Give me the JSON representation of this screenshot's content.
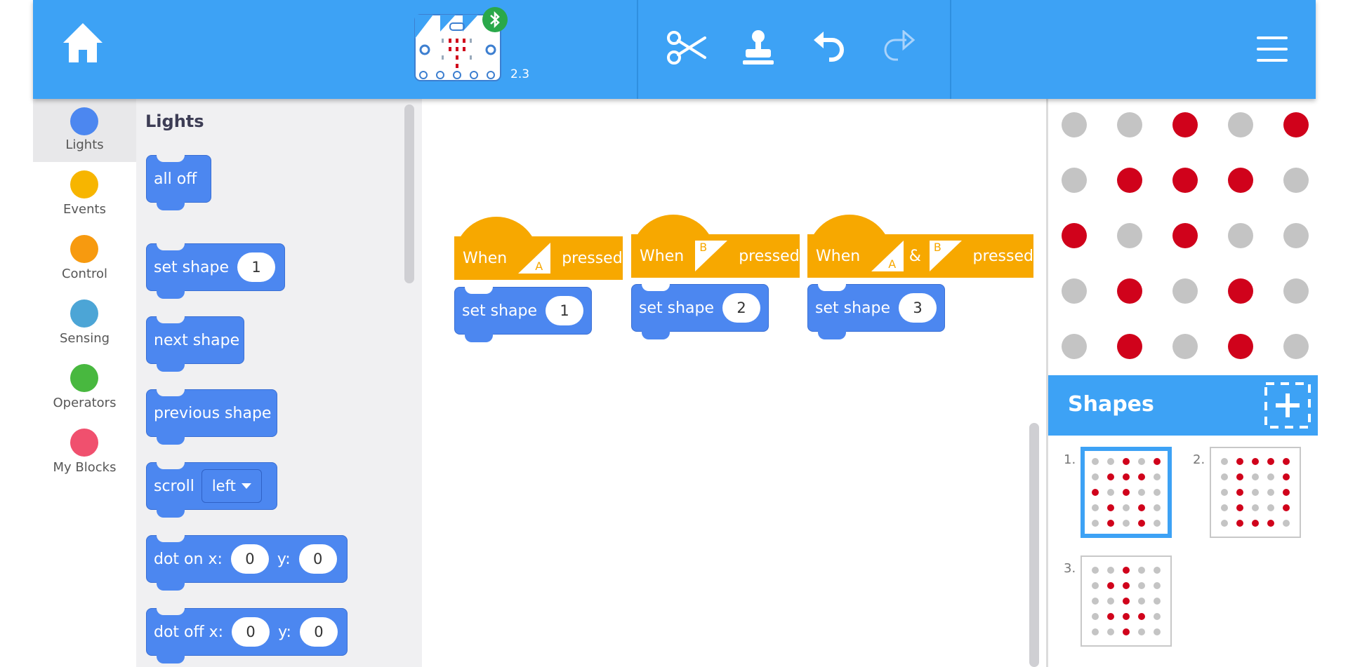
{
  "header": {
    "device_version": "2.3",
    "icons": [
      "home-icon",
      "microbit-device-icon",
      "bluetooth-icon",
      "scissors-icon",
      "stamp-icon",
      "undo-icon",
      "redo-icon",
      "menu-icon"
    ]
  },
  "categories": [
    {
      "label": "Lights",
      "color": "#4c87f0",
      "active": true
    },
    {
      "label": "Events",
      "color": "#f7b500",
      "active": false
    },
    {
      "label": "Control",
      "color": "#f79a0f",
      "active": false
    },
    {
      "label": "Sensing",
      "color": "#4ca5d6",
      "active": false
    },
    {
      "label": "Operators",
      "color": "#48b83f",
      "active": false
    },
    {
      "label": "My Blocks",
      "color": "#f0506e",
      "active": false
    }
  ],
  "palette": {
    "title": "Lights",
    "all_off": "all off",
    "set_shape": {
      "label": "set shape",
      "value": "1"
    },
    "next_shape": "next shape",
    "previous_shape": "previous shape",
    "scroll": {
      "label": "scroll",
      "option": "left"
    },
    "dot_on": {
      "label": "dot on x:",
      "x": "0",
      "y_label": "y:",
      "y": "0"
    },
    "dot_off": {
      "label": "dot off x:",
      "x": "0",
      "y_label": "y:",
      "y": "0"
    }
  },
  "workspace": {
    "scripts": [
      {
        "when": "When",
        "buttons": [
          "A"
        ],
        "pressed": "pressed",
        "action": "set shape",
        "value": "1"
      },
      {
        "when": "When",
        "buttons": [
          "B"
        ],
        "pressed": "pressed",
        "action": "set shape",
        "value": "2"
      },
      {
        "when": "When",
        "buttons": [
          "A",
          "B"
        ],
        "amp": "&",
        "pressed": "pressed",
        "action": "set shape",
        "value": "3"
      }
    ]
  },
  "led_grid": {
    "on_color": "#d0021b",
    "off_color": "#c4c4c4",
    "rows": [
      [
        0,
        0,
        1,
        0,
        1
      ],
      [
        0,
        1,
        1,
        1,
        0
      ],
      [
        1,
        0,
        1,
        0,
        0
      ],
      [
        0,
        1,
        0,
        1,
        0
      ],
      [
        0,
        1,
        0,
        1,
        0
      ]
    ]
  },
  "shapes": {
    "title": "Shapes",
    "items": [
      {
        "num": "1.",
        "selected": true,
        "rows": [
          [
            0,
            0,
            1,
            0,
            1
          ],
          [
            0,
            1,
            1,
            1,
            0
          ],
          [
            1,
            0,
            1,
            0,
            0
          ],
          [
            0,
            1,
            0,
            1,
            0
          ],
          [
            0,
            1,
            0,
            1,
            0
          ]
        ]
      },
      {
        "num": "2.",
        "selected": false,
        "rows": [
          [
            0,
            1,
            1,
            1,
            1
          ],
          [
            0,
            1,
            0,
            0,
            1
          ],
          [
            0,
            1,
            0,
            0,
            1
          ],
          [
            0,
            1,
            0,
            0,
            1
          ],
          [
            0,
            1,
            1,
            1,
            0
          ]
        ]
      },
      {
        "num": "3.",
        "selected": false,
        "rows": [
          [
            0,
            0,
            1,
            0,
            0
          ],
          [
            0,
            1,
            1,
            0,
            0
          ],
          [
            0,
            0,
            1,
            0,
            0
          ],
          [
            0,
            1,
            1,
            1,
            0
          ],
          [
            0,
            0,
            1,
            0,
            0
          ]
        ]
      }
    ]
  }
}
